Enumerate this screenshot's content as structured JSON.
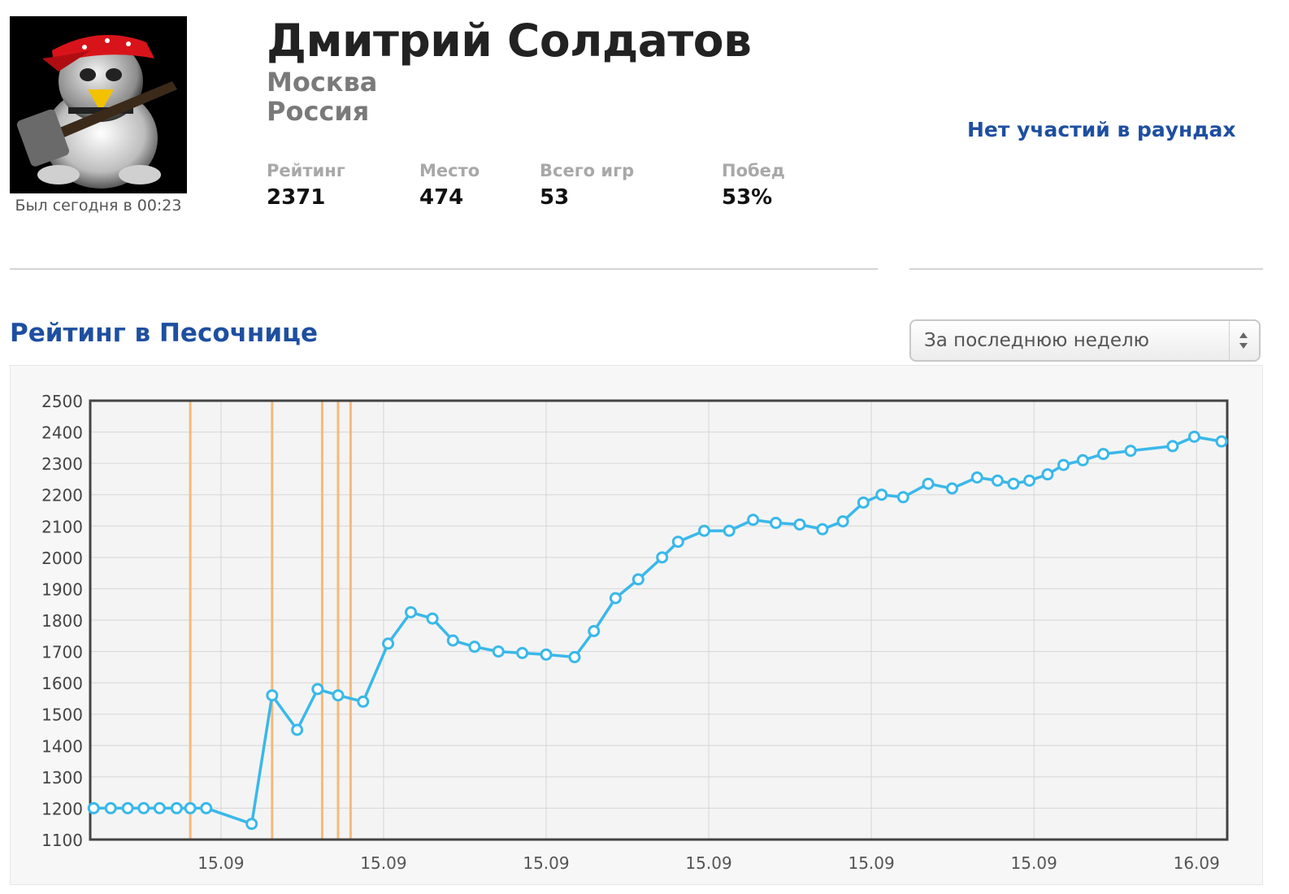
{
  "profile": {
    "name": "Дмитрий Солдатов",
    "city": "Москва",
    "country": "Россия",
    "last_seen": "Был сегодня в 00:23",
    "avatar_icon": "penguin-guitarist-icon"
  },
  "stats": [
    {
      "label": "Рейтинг",
      "value": "2371"
    },
    {
      "label": "Место",
      "value": "474"
    },
    {
      "label": "Всего игр",
      "value": "53"
    },
    {
      "label": "Побед",
      "value": "53%"
    }
  ],
  "rounds": {
    "text": "Нет участий в раундах"
  },
  "section": {
    "title": "Рейтинг в Песочнице"
  },
  "period_select": {
    "selected": "За последнюю неделю"
  },
  "colors": {
    "title_blue": "#1e4fa0",
    "series": "#3ab8ea",
    "event_markers": "#f7b978",
    "plot_bg": "#f4f4f4"
  },
  "chart_data": {
    "type": "line",
    "title": "",
    "xlabel": "",
    "ylabel": "",
    "ylim": [
      1100,
      2500
    ],
    "yticks": [
      1100,
      1200,
      1300,
      1400,
      1500,
      1600,
      1700,
      1800,
      1900,
      2000,
      2100,
      2200,
      2300,
      2400,
      2500
    ],
    "xlim": [
      0,
      1
    ],
    "xticks": [
      {
        "pos": 0.115,
        "label": "15.09"
      },
      {
        "pos": 0.258,
        "label": "15.09"
      },
      {
        "pos": 0.401,
        "label": "15.09"
      },
      {
        "pos": 0.544,
        "label": "15.09"
      },
      {
        "pos": 0.687,
        "label": "15.09"
      },
      {
        "pos": 0.83,
        "label": "15.09"
      },
      {
        "pos": 0.973,
        "label": "16.09"
      }
    ],
    "grid": true,
    "event_markers": [
      0.088,
      0.16,
      0.204,
      0.218,
      0.229
    ],
    "series": [
      {
        "x": [
          0.003,
          0.018,
          0.033,
          0.047,
          0.061,
          0.076,
          0.088,
          0.102,
          0.142,
          0.16,
          0.182,
          0.2,
          0.218,
          0.24,
          0.262,
          0.282,
          0.301,
          0.319,
          0.338,
          0.359,
          0.38,
          0.401,
          0.426,
          0.443,
          0.462,
          0.482,
          0.503,
          0.517,
          0.54,
          0.562,
          0.583,
          0.603,
          0.624,
          0.644,
          0.662,
          0.68,
          0.696,
          0.715,
          0.737,
          0.758,
          0.78,
          0.798,
          0.812,
          0.826,
          0.842,
          0.856,
          0.873,
          0.891,
          0.915,
          0.952,
          0.971,
          0.995
        ],
        "values": [
          1200,
          1200,
          1200,
          1200,
          1200,
          1200,
          1200,
          1200,
          1150,
          1560,
          1450,
          1580,
          1560,
          1540,
          1725,
          1825,
          1805,
          1735,
          1715,
          1700,
          1695,
          1690,
          1682,
          1765,
          1870,
          1930,
          2000,
          2050,
          2085,
          2085,
          2120,
          2110,
          2105,
          2090,
          2115,
          2175,
          2200,
          2192,
          2235,
          2220,
          2255,
          2245,
          2235,
          2245,
          2265,
          2295,
          2310,
          2330,
          2340,
          2355,
          2385,
          2370
        ]
      }
    ]
  }
}
